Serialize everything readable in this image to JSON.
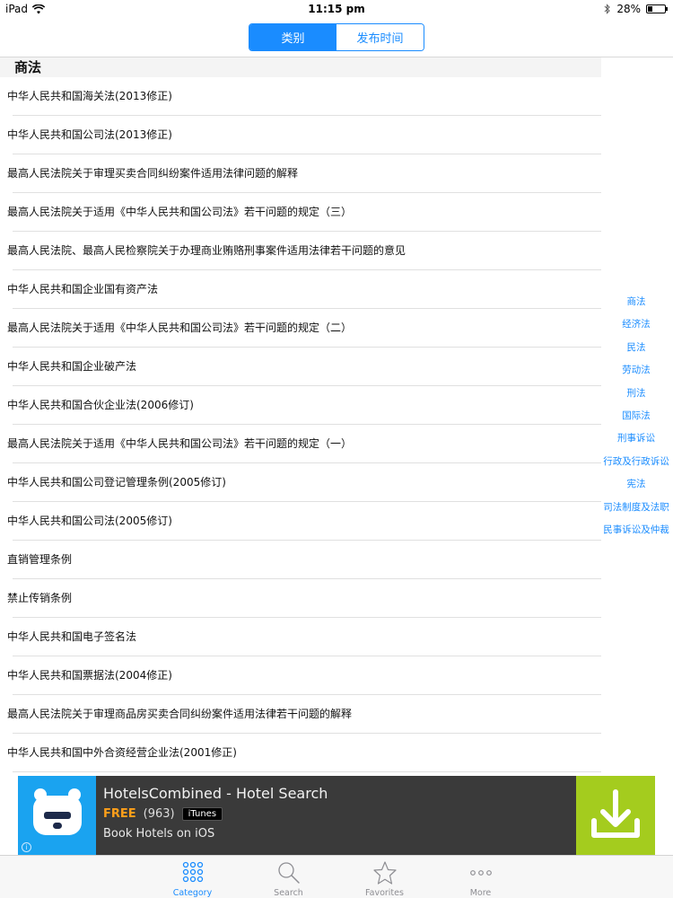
{
  "status_bar": {
    "device": "iPad",
    "time": "11:15 pm",
    "battery": "28%",
    "battery_level": 0.28
  },
  "segmented_control": {
    "options": [
      "类别",
      "发布时间"
    ],
    "selected_index": 0
  },
  "section": {
    "title": "商法"
  },
  "list_items": [
    "中华人民共和国海关法(2013修正)",
    "中华人民共和国公司法(2013修正)",
    "最高人民法院关于审理买卖合同纠纷案件适用法律问题的解释",
    "最高人民法院关于适用《中华人民共和国公司法》若干问题的规定（三）",
    "最高人民法院、最高人民检察院关于办理商业贿赂刑事案件适用法律若干问题的意见",
    "中华人民共和国企业国有资产法",
    "最高人民法院关于适用《中华人民共和国公司法》若干问题的规定（二）",
    "中华人民共和国企业破产法",
    "中华人民共和国合伙企业法(2006修订)",
    "最高人民法院关于适用《中华人民共和国公司法》若干问题的规定（一）",
    "中华人民共和国公司登记管理条例(2005修订)",
    "中华人民共和国公司法(2005修订)",
    "直销管理条例",
    "禁止传销条例",
    "中华人民共和国电子签名法",
    "中华人民共和国票据法(2004修正)",
    "最高人民法院关于审理商品房买卖合同纠纷案件适用法律若干问题的解释",
    "中华人民共和国中外合资经营企业法(2001修正)"
  ],
  "index_items": [
    "商法",
    "经济法",
    "民法",
    "劳动法",
    "刑法",
    "国际法",
    "刑事诉讼",
    "行政及行政诉讼",
    "宪法",
    "司法制度及法职",
    "民事诉讼及仲裁"
  ],
  "ad": {
    "title": "HotelsCombined - Hotel Search",
    "price": "FREE",
    "rating_count": "(963)",
    "store_badge": "iTunes",
    "subtitle": "Book Hotels on iOS",
    "info_glyph": "i",
    "icon": "bear-logo-icon",
    "action_icon": "download-icon"
  },
  "tabs": [
    {
      "label": "Category",
      "icon": "grid-icon"
    },
    {
      "label": "Search",
      "icon": "search-icon"
    },
    {
      "label": "Favorites",
      "icon": "star-icon"
    },
    {
      "label": "More",
      "icon": "more-icon"
    }
  ],
  "selected_tab": 0,
  "colors": {
    "accent": "#1a8cff",
    "ad_background": "#3a3a3a",
    "ad_icon_background": "#1aa3f0",
    "ad_download_background": "#a4cc1e",
    "ad_price": "#ff9f1a"
  }
}
